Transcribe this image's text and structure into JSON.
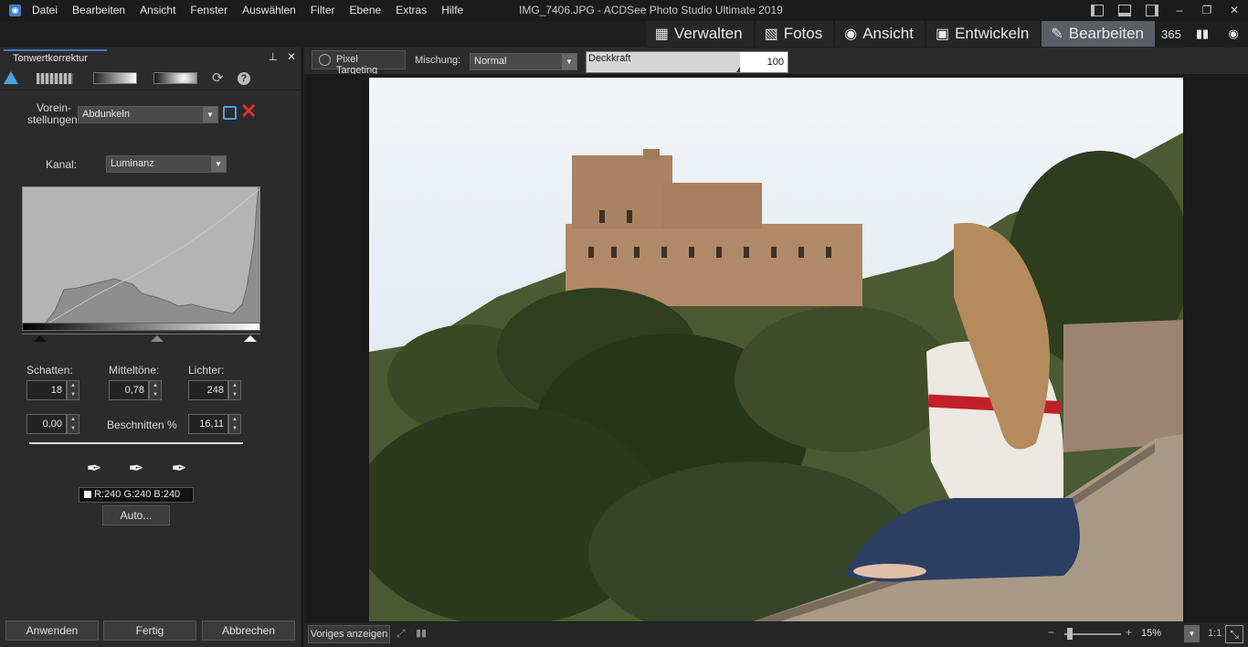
{
  "titlebar": {
    "menu": [
      "Datei",
      "Bearbeiten",
      "Ansicht",
      "Fenster",
      "Auswählen",
      "Filter",
      "Ebene",
      "Extras",
      "Hilfe"
    ],
    "title": "IMG_7406.JPG - ACDSee Photo Studio Ultimate 2019",
    "buttons": [
      "–",
      "❐",
      "✕"
    ]
  },
  "modes": {
    "tabs": [
      {
        "label": "Verwalten",
        "icon": "grid-icon",
        "glyph": "▦",
        "active": false
      },
      {
        "label": "Fotos",
        "icon": "photos-icon",
        "glyph": "🖼",
        "active": false
      },
      {
        "label": "Ansicht",
        "icon": "eye-icon",
        "glyph": "👁",
        "active": false
      },
      {
        "label": "Entwickeln",
        "icon": "develop-icon",
        "glyph": "▣",
        "active": false
      },
      {
        "label": "Bearbeiten",
        "icon": "edit-icon",
        "glyph": "✎",
        "active": true
      }
    ],
    "extra_icons": [
      {
        "name": "365-icon",
        "glyph": "365"
      },
      {
        "name": "dashboard-icon",
        "glyph": "▮▮"
      },
      {
        "name": "refresh-eye-icon",
        "glyph": "◉"
      }
    ]
  },
  "panel": {
    "tab_label": "Tonwertkorrektur",
    "pin_glyph": "⊥",
    "close_glyph": "✕",
    "presets_label": "Vorein-\nstellungen",
    "preset_value": "Abdunkeln",
    "channel_label": "Kanal:",
    "channel_value": "Luminanz",
    "shadows_label": "Schatten:",
    "midtones_label": "Mitteltöne:",
    "highlights_label": "Lichter:",
    "shadows_value": "18",
    "midtones_value": "0,78",
    "highlights_value": "248",
    "clip_low": "0,00",
    "clip_label": "Beschnitten %",
    "clip_high": "16,11",
    "rgb_readout": "R:240  G:240  B:240",
    "auto_label": "Auto...",
    "apply_label": "Anwenden",
    "done_label": "Fertig",
    "cancel_label": "Abbrechen"
  },
  "options": {
    "pixel_targeting": "Pixel Targeting",
    "blend_label": "Mischung:",
    "blend_value": "Normal",
    "opacity_label": "Deckkraft",
    "opacity_value": "100"
  },
  "status": {
    "prev_label": "Voriges anzeigen",
    "zoom_value": "15%",
    "one_to_one": "1:1"
  },
  "colors": {
    "accent": "#3a7bd5",
    "active_tab": "#5a5f66",
    "delete_red": "#e03030"
  }
}
